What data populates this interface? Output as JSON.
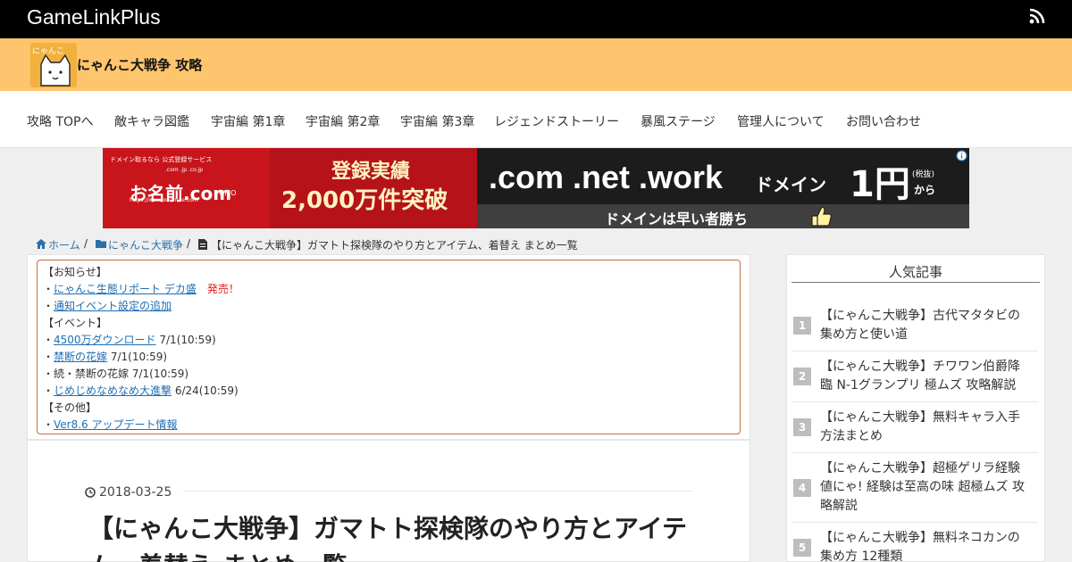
{
  "header": {
    "site_name": "GameLinkPlus",
    "rss_icon": "rss-icon",
    "brand_title": "にゃんこ大戦争 攻略",
    "logo_text": "にゃんこ",
    "brand_color": "#fdc56d"
  },
  "nav": {
    "items": [
      {
        "label": "攻略 TOPへ"
      },
      {
        "label": "敵キャラ図鑑"
      },
      {
        "label": "宇宙編 第1章"
      },
      {
        "label": "宇宙編 第2章"
      },
      {
        "label": "宇宙編 第3章"
      },
      {
        "label": "レジェンドストーリー"
      },
      {
        "label": "暴風ステージ"
      },
      {
        "label": "管理人について"
      },
      {
        "label": "お問い合わせ"
      }
    ]
  },
  "ad": {
    "tag": "ドメイン取るなら 公式登録サービス",
    "brand": "お名前.com",
    "tlds": ".com .jp .co.jp",
    "gmo": "GMO",
    "url": "https://www.onamae.com",
    "line1": "登録実績",
    "line2": "2,000万件突破",
    "domains": ".com .net .work",
    "domain_word": "ドメイン",
    "price": "1円",
    "tax": "(税抜)",
    "from": "から",
    "slogan": "ドメインは早い者勝ち",
    "info_icon": "info-icon"
  },
  "breadcrumb": {
    "home": "ホーム",
    "category": "にゃんこ大戦争",
    "current": "【にゃんこ大戦争】ガマトト探検隊のやり方とアイテム、着替え まとめ一覧",
    "separator": "/"
  },
  "notice": {
    "lines": [
      {
        "prefix": "【お知らせ】",
        "link": "",
        "suffix": "",
        "hot": ""
      },
      {
        "prefix": "・",
        "link": "にゃんこ生態リポート デカ盛",
        "suffix": "",
        "hot": "発売！"
      },
      {
        "prefix": "・",
        "link": "通知イベント設定の追加",
        "suffix": "",
        "hot": ""
      },
      {
        "prefix": "【イベント】",
        "link": "",
        "suffix": "",
        "hot": ""
      },
      {
        "prefix": "・",
        "link": "4500万ダウンロード",
        "suffix": " 7/1(10:59)",
        "hot": ""
      },
      {
        "prefix": "・",
        "link": "禁断の花嫁",
        "suffix": " 7/1(10:59)",
        "hot": ""
      },
      {
        "prefix": "・続・禁断の花嫁",
        "link": "",
        "suffix": " 7/1(10:59)",
        "hot": ""
      },
      {
        "prefix": "・",
        "link": "じめじめなめなめ大進撃",
        "suffix": " 6/24(10:59)",
        "hot": ""
      },
      {
        "prefix": "【その他】",
        "link": "",
        "suffix": "",
        "hot": ""
      },
      {
        "prefix": "・",
        "link": "Ver8.6 アップデート情報",
        "suffix": "",
        "hot": ""
      }
    ]
  },
  "article": {
    "date": "2018-03-25",
    "title": "【にゃんこ大戦争】ガマトト探検隊のやり方とアイテム、着替え まとめ一覧"
  },
  "sidebar": {
    "heading": "人気記事",
    "items": [
      {
        "rank": "1",
        "title": "【にゃんこ大戦争】古代マタタビの集め方と使い道"
      },
      {
        "rank": "2",
        "title": "【にゃんこ大戦争】チワワン伯爵降臨 N-1グランプリ 極ムズ 攻略解説"
      },
      {
        "rank": "3",
        "title": "【にゃんこ大戦争】無料キャラ入手方法まとめ"
      },
      {
        "rank": "4",
        "title": "【にゃんこ大戦争】超極ゲリラ経験値にゃ! 経験は至高の味 超極ムズ 攻略解説"
      },
      {
        "rank": "5",
        "title": "【にゃんこ大戦争】無料ネコカンの集め方 12種類"
      }
    ]
  }
}
